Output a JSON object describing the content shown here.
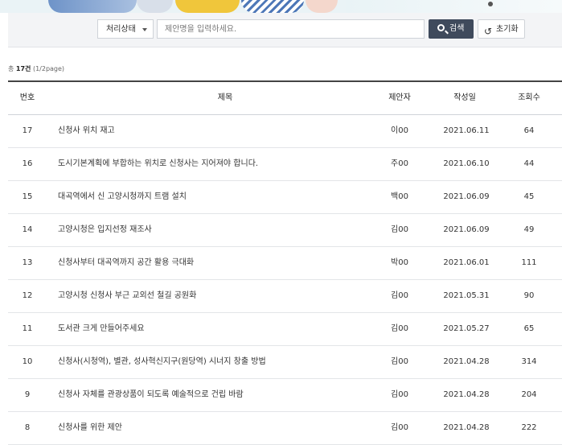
{
  "search": {
    "select_label": "처리상태",
    "input_placeholder": "제안명을 입력하세요.",
    "search_label": "검색",
    "reset_label": "초기화"
  },
  "count": {
    "prefix": "총 ",
    "total": "17건",
    "pages": " (1/2page)"
  },
  "table": {
    "headers": {
      "no": "번호",
      "title": "제목",
      "author": "제안자",
      "date": "작성일",
      "views": "조회수"
    },
    "rows": [
      {
        "no": "17",
        "title": "신청사 위치 재고",
        "author": "이00",
        "date": "2021.06.11",
        "views": "64"
      },
      {
        "no": "16",
        "title": "도시기본계획에 부합하는 위치로 신청사는 지어져야 합니다.",
        "author": "주00",
        "date": "2021.06.10",
        "views": "44"
      },
      {
        "no": "15",
        "title": "대곡역에서 신 고양시청까지 트램 설치",
        "author": "백00",
        "date": "2021.06.09",
        "views": "45"
      },
      {
        "no": "14",
        "title": "고양시청은 입지선정 재조사",
        "author": "김00",
        "date": "2021.06.09",
        "views": "49"
      },
      {
        "no": "13",
        "title": "신청사부터 대곡역까지 공간 활용 극대화",
        "author": "박00",
        "date": "2021.06.01",
        "views": "111"
      },
      {
        "no": "12",
        "title": "고양시청 신청사 부근 교외선 철길 공원화",
        "author": "김00",
        "date": "2021.05.31",
        "views": "90"
      },
      {
        "no": "11",
        "title": "도서관 크게 만들어주세요",
        "author": "김00",
        "date": "2021.05.27",
        "views": "65"
      },
      {
        "no": "10",
        "title": "신청사(시청역), 별관, 성사혁신지구(원당역) 시너지 창출 방법",
        "author": "김00",
        "date": "2021.04.28",
        "views": "314"
      },
      {
        "no": "9",
        "title": "신청사 자체를 관광상품이 되도록 예술적으로 건립 바람",
        "author": "김00",
        "date": "2021.04.28",
        "views": "204"
      },
      {
        "no": "8",
        "title": "신청사를 위한 제안",
        "author": "김00",
        "date": "2021.04.28",
        "views": "222"
      }
    ]
  }
}
